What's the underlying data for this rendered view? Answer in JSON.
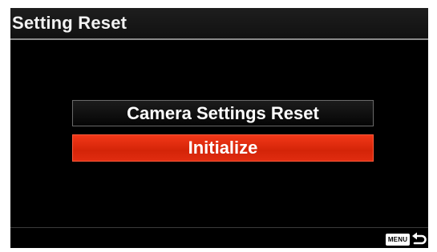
{
  "header": {
    "title": "Setting Reset"
  },
  "menu": {
    "items": [
      {
        "label": "Camera Settings Reset",
        "selected": false
      },
      {
        "label": "Initialize",
        "selected": true
      }
    ]
  },
  "footer": {
    "menu_key_label": "MENU",
    "back_icon": "return-arrow-icon"
  },
  "colors": {
    "background": "#000000",
    "selected_item": "#e0300f",
    "text": "#ffffff"
  }
}
